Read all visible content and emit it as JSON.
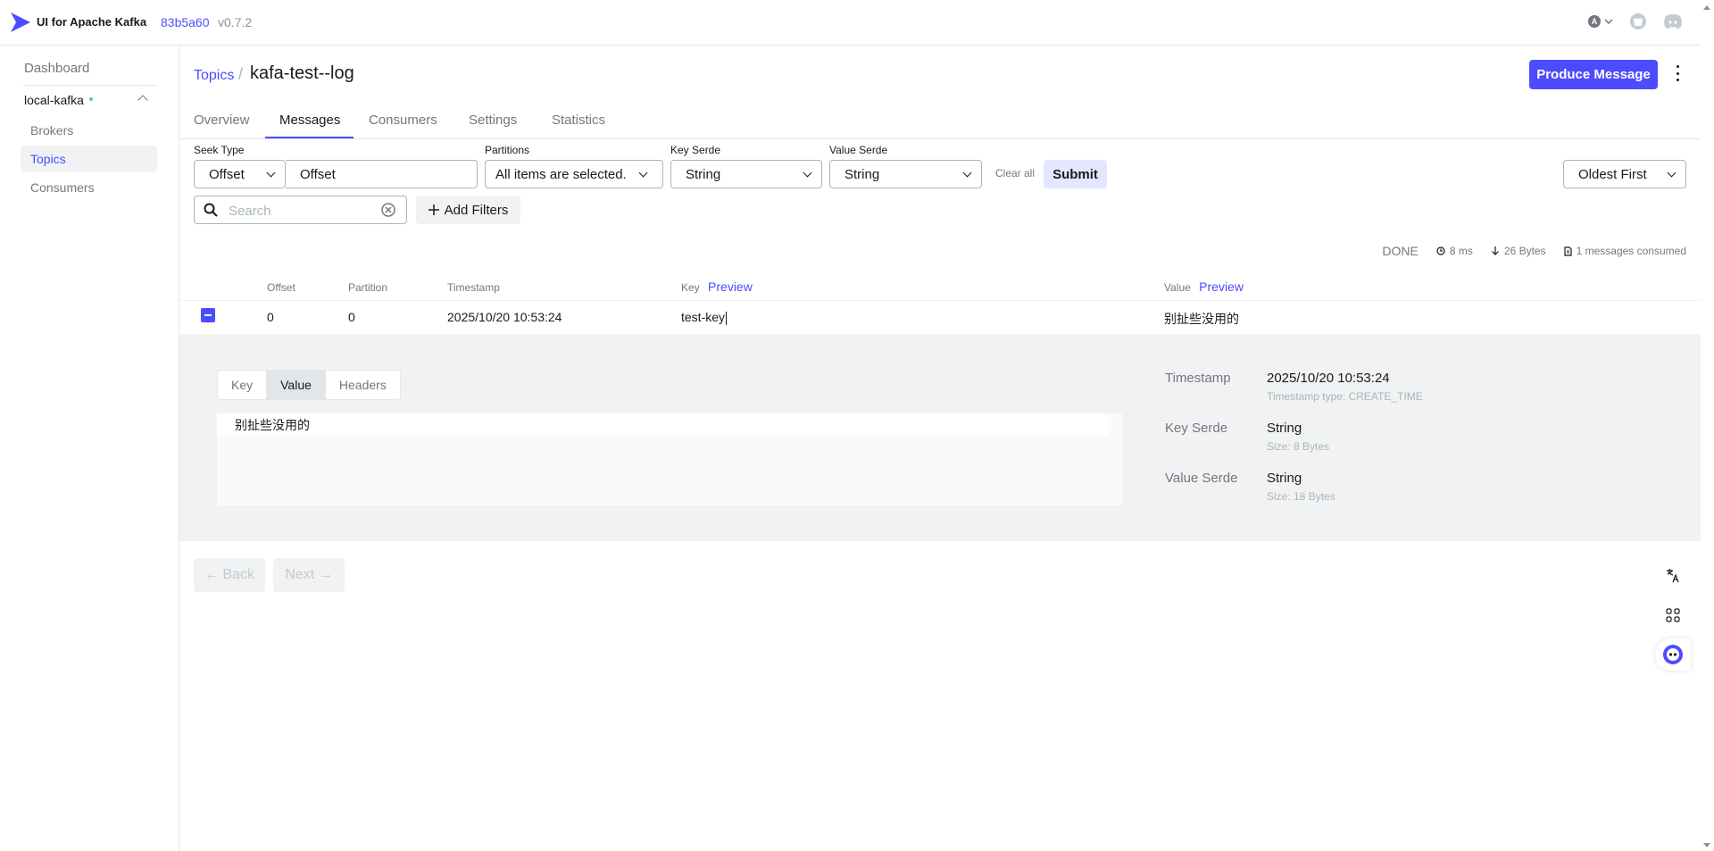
{
  "header": {
    "brand": "UI for Apache Kafka",
    "version_hash": "83b5a60",
    "version_num": "v0.7.2",
    "avatar_letter": "A"
  },
  "sidebar": {
    "dashboard": "Dashboard",
    "cluster": "local-kafka",
    "items": [
      {
        "label": "Brokers"
      },
      {
        "label": "Topics"
      },
      {
        "label": "Consumers"
      }
    ]
  },
  "breadcrumb": {
    "topics": "Topics",
    "separator": "/",
    "title": "kafa-test--log"
  },
  "actions": {
    "produce": "Produce Message"
  },
  "tabs": [
    {
      "label": "Overview"
    },
    {
      "label": "Messages"
    },
    {
      "label": "Consumers"
    },
    {
      "label": "Settings"
    },
    {
      "label": "Statistics"
    }
  ],
  "filters": {
    "seek_type_label": "Seek Type",
    "seek_type_value": "Offset",
    "offset_value": "Offset",
    "partitions_label": "Partitions",
    "partitions_value": "All items are selected.",
    "key_serde_label": "Key Serde",
    "key_serde_value": "String",
    "value_serde_label": "Value Serde",
    "value_serde_value": "String",
    "clear_all": "Clear all",
    "submit": "Submit",
    "sort_value": "Oldest First",
    "search_placeholder": "Search",
    "add_filters": "Add Filters"
  },
  "stats": {
    "status": "DONE",
    "time": "8 ms",
    "bytes": "26 Bytes",
    "consumed": "1 messages consumed"
  },
  "table": {
    "headers": {
      "offset": "Offset",
      "partition": "Partition",
      "timestamp": "Timestamp",
      "key": "Key",
      "value": "Value",
      "preview": "Preview"
    },
    "rows": [
      {
        "offset": "0",
        "partition": "0",
        "timestamp": "2025/10/20 10:53:24",
        "key": "test-key",
        "value": "别扯些没用的"
      }
    ]
  },
  "detail": {
    "tabs": [
      "Key",
      "Value",
      "Headers"
    ],
    "active_tab": "Value",
    "content": "别扯些没用的",
    "meta": {
      "timestamp_label": "Timestamp",
      "timestamp_value": "2025/10/20 10:53:24",
      "timestamp_type": "Timestamp type: CREATE_TIME",
      "key_serde_label": "Key Serde",
      "key_serde_value": "String",
      "key_size": "Size: 8 Bytes",
      "value_serde_label": "Value Serde",
      "value_serde_value": "String",
      "value_size": "Size: 18 Bytes"
    }
  },
  "pager": {
    "back": "← Back",
    "next": "Next →"
  },
  "colors": {
    "accent": "#4c4cff",
    "muted": "#73787e",
    "border": "#e3e6e8",
    "panel": "#f1f2f3",
    "online": "#5cd685"
  }
}
